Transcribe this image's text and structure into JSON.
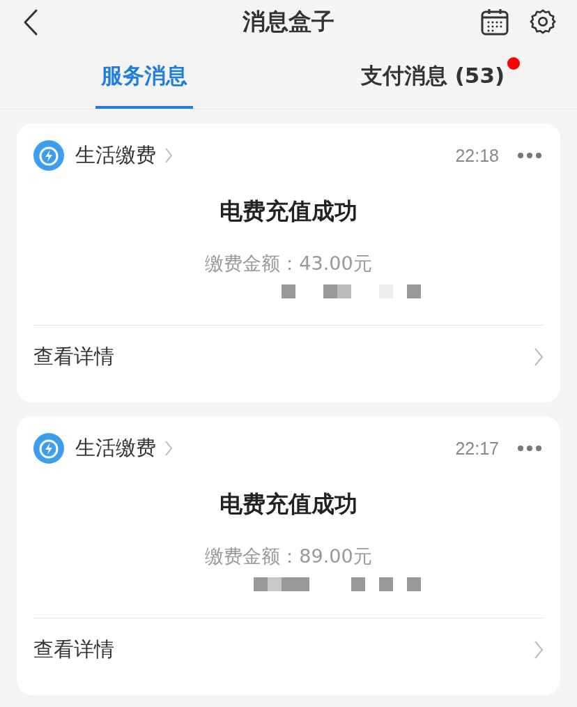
{
  "header": {
    "title": "消息盒子"
  },
  "tabs": [
    {
      "label": "服务消息",
      "selected": true,
      "unread_dot": false
    },
    {
      "label": "支付消息 (53)",
      "selected": false,
      "unread_dot": true
    }
  ],
  "messages": [
    {
      "service": "生活缴费",
      "time": "22:18",
      "title": "电费充值成功",
      "amount": "缴费金额：43.00元",
      "details": "查看详情"
    },
    {
      "service": "生活缴费",
      "time": "22:17",
      "title": "电费充值成功",
      "amount": "缴费金额：89.00元",
      "details": "查看详情"
    }
  ]
}
